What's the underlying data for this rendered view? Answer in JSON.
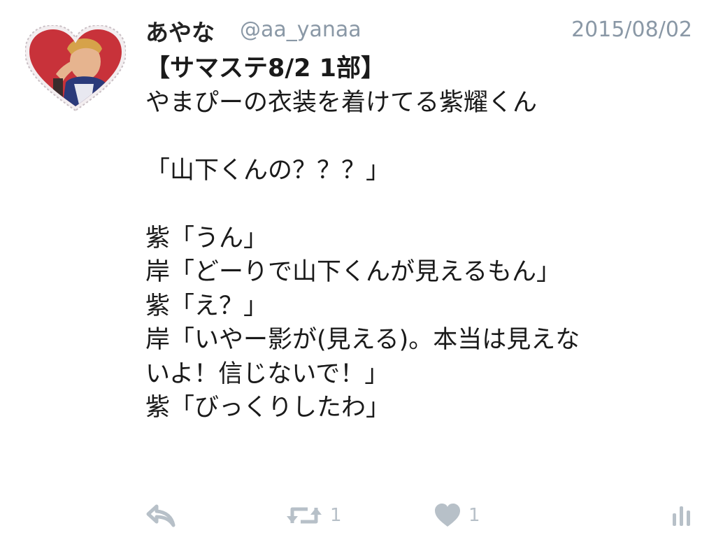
{
  "tweet": {
    "author": {
      "display_name": "あやな",
      "username": "@aa_yanaa"
    },
    "timestamp": "2015/08/02",
    "body_lines": [
      "【サマステ8/2 1部】",
      "やまぴーの衣装を着けてる紫耀くん",
      "",
      "「山下くんの？？？」",
      "",
      "紫「うん」",
      "岸「どーりで山下くんが見えるもん」",
      "紫「え？」",
      "岸「いやー影が(見える)。本当は見えな",
      "いよ！信じないで！」",
      "紫「びっくりしたわ」"
    ],
    "actions": {
      "retweet_count": "1",
      "like_count": "1"
    }
  },
  "icons": {
    "avatar": "heart-frame-avatar",
    "reply": "reply-icon",
    "retweet": "retweet-icon",
    "like": "heart-icon",
    "analytics": "analytics-icon"
  },
  "colors": {
    "icon_gray": "#b7c0c8",
    "meta_gray": "#8a98a6",
    "heart_red": "#c8323a"
  }
}
